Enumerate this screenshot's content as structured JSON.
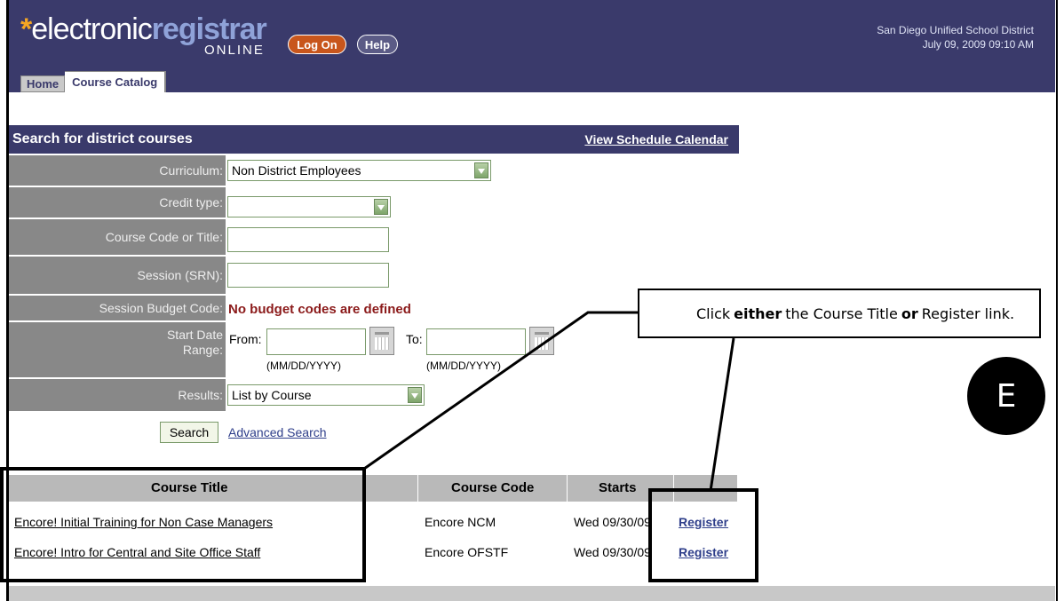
{
  "header": {
    "logo_star": "*",
    "logo_main": "electronic",
    "logo_reg": "registrar",
    "logo_sub": "ONLINE",
    "logon_label": "Log On",
    "help_label": "Help",
    "district": "San Diego Unified School District",
    "datetime": "July 09, 2009 09:10 AM"
  },
  "tabs": [
    {
      "label": "Home"
    },
    {
      "label": "Course Catalog"
    }
  ],
  "search": {
    "title": "Search for district courses",
    "calendar_link": "View Schedule Calendar",
    "fields": {
      "curriculum_label": "Curriculum:",
      "curriculum_value": "Non District Employees",
      "credit_label": "Credit type:",
      "credit_value": "",
      "code_label": "Course Code or Title:",
      "code_value": "",
      "session_label": "Session (SRN):",
      "session_value": "",
      "budget_label": "Session Budget Code:",
      "budget_value": "No budget codes are defined",
      "date_label_1": "Start Date",
      "date_label_2": "Range:",
      "from_label": "From:",
      "to_label": "To:",
      "date_format": "(MM/DD/YYYY)",
      "results_label": "Results:",
      "results_value": "List by Course"
    },
    "search_button": "Search",
    "advanced_link": "Advanced Search"
  },
  "results": {
    "columns": [
      "Course Title",
      "Course Code",
      "Starts",
      ""
    ],
    "rows": [
      {
        "title": "Encore! Initial Training for Non Case Managers",
        "code": "Encore NCM",
        "starts": "Wed 09/30/09",
        "action": "Register"
      },
      {
        "title": "Encore! Intro for Central and Site Office Staff",
        "code": "Encore OFSTF",
        "starts": "Wed 09/30/09",
        "action": "Register"
      }
    ]
  },
  "annotation": {
    "callout_part1": "Click",
    "callout_either": "either",
    "callout_part2": "the Course Title",
    "callout_or": "or",
    "callout_part3": "Register link.",
    "badge": "E"
  },
  "colors": {
    "header_bg": "#3a3a6b",
    "accent_orange": "#c8561c",
    "budget_red": "#8b1a1a",
    "link_blue": "#2e3e8a"
  }
}
